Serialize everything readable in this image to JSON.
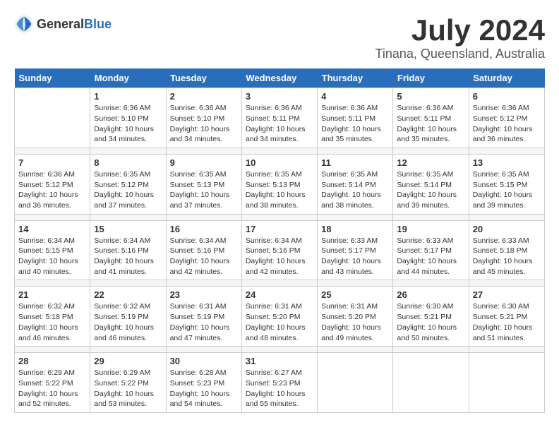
{
  "logo": {
    "general": "General",
    "blue": "Blue"
  },
  "title": "July 2024",
  "subtitle": "Tinana, Queensland, Australia",
  "days_of_week": [
    "Sunday",
    "Monday",
    "Tuesday",
    "Wednesday",
    "Thursday",
    "Friday",
    "Saturday"
  ],
  "weeks": [
    [
      {
        "day": "",
        "info": ""
      },
      {
        "day": "1",
        "info": "Sunrise: 6:36 AM\nSunset: 5:10 PM\nDaylight: 10 hours\nand 34 minutes."
      },
      {
        "day": "2",
        "info": "Sunrise: 6:36 AM\nSunset: 5:10 PM\nDaylight: 10 hours\nand 34 minutes."
      },
      {
        "day": "3",
        "info": "Sunrise: 6:36 AM\nSunset: 5:11 PM\nDaylight: 10 hours\nand 34 minutes."
      },
      {
        "day": "4",
        "info": "Sunrise: 6:36 AM\nSunset: 5:11 PM\nDaylight: 10 hours\nand 35 minutes."
      },
      {
        "day": "5",
        "info": "Sunrise: 6:36 AM\nSunset: 5:11 PM\nDaylight: 10 hours\nand 35 minutes."
      },
      {
        "day": "6",
        "info": "Sunrise: 6:36 AM\nSunset: 5:12 PM\nDaylight: 10 hours\nand 36 minutes."
      }
    ],
    [
      {
        "day": "7",
        "info": "Sunrise: 6:36 AM\nSunset: 5:12 PM\nDaylight: 10 hours\nand 36 minutes."
      },
      {
        "day": "8",
        "info": "Sunrise: 6:35 AM\nSunset: 5:12 PM\nDaylight: 10 hours\nand 37 minutes."
      },
      {
        "day": "9",
        "info": "Sunrise: 6:35 AM\nSunset: 5:13 PM\nDaylight: 10 hours\nand 37 minutes."
      },
      {
        "day": "10",
        "info": "Sunrise: 6:35 AM\nSunset: 5:13 PM\nDaylight: 10 hours\nand 38 minutes."
      },
      {
        "day": "11",
        "info": "Sunrise: 6:35 AM\nSunset: 5:14 PM\nDaylight: 10 hours\nand 38 minutes."
      },
      {
        "day": "12",
        "info": "Sunrise: 6:35 AM\nSunset: 5:14 PM\nDaylight: 10 hours\nand 39 minutes."
      },
      {
        "day": "13",
        "info": "Sunrise: 6:35 AM\nSunset: 5:15 PM\nDaylight: 10 hours\nand 39 minutes."
      }
    ],
    [
      {
        "day": "14",
        "info": "Sunrise: 6:34 AM\nSunset: 5:15 PM\nDaylight: 10 hours\nand 40 minutes."
      },
      {
        "day": "15",
        "info": "Sunrise: 6:34 AM\nSunset: 5:16 PM\nDaylight: 10 hours\nand 41 minutes."
      },
      {
        "day": "16",
        "info": "Sunrise: 6:34 AM\nSunset: 5:16 PM\nDaylight: 10 hours\nand 42 minutes."
      },
      {
        "day": "17",
        "info": "Sunrise: 6:34 AM\nSunset: 5:16 PM\nDaylight: 10 hours\nand 42 minutes."
      },
      {
        "day": "18",
        "info": "Sunrise: 6:33 AM\nSunset: 5:17 PM\nDaylight: 10 hours\nand 43 minutes."
      },
      {
        "day": "19",
        "info": "Sunrise: 6:33 AM\nSunset: 5:17 PM\nDaylight: 10 hours\nand 44 minutes."
      },
      {
        "day": "20",
        "info": "Sunrise: 6:33 AM\nSunset: 5:18 PM\nDaylight: 10 hours\nand 45 minutes."
      }
    ],
    [
      {
        "day": "21",
        "info": "Sunrise: 6:32 AM\nSunset: 5:18 PM\nDaylight: 10 hours\nand 46 minutes."
      },
      {
        "day": "22",
        "info": "Sunrise: 6:32 AM\nSunset: 5:19 PM\nDaylight: 10 hours\nand 46 minutes."
      },
      {
        "day": "23",
        "info": "Sunrise: 6:31 AM\nSunset: 5:19 PM\nDaylight: 10 hours\nand 47 minutes."
      },
      {
        "day": "24",
        "info": "Sunrise: 6:31 AM\nSunset: 5:20 PM\nDaylight: 10 hours\nand 48 minutes."
      },
      {
        "day": "25",
        "info": "Sunrise: 6:31 AM\nSunset: 5:20 PM\nDaylight: 10 hours\nand 49 minutes."
      },
      {
        "day": "26",
        "info": "Sunrise: 6:30 AM\nSunset: 5:21 PM\nDaylight: 10 hours\nand 50 minutes."
      },
      {
        "day": "27",
        "info": "Sunrise: 6:30 AM\nSunset: 5:21 PM\nDaylight: 10 hours\nand 51 minutes."
      }
    ],
    [
      {
        "day": "28",
        "info": "Sunrise: 6:29 AM\nSunset: 5:22 PM\nDaylight: 10 hours\nand 52 minutes."
      },
      {
        "day": "29",
        "info": "Sunrise: 6:29 AM\nSunset: 5:22 PM\nDaylight: 10 hours\nand 53 minutes."
      },
      {
        "day": "30",
        "info": "Sunrise: 6:28 AM\nSunset: 5:23 PM\nDaylight: 10 hours\nand 54 minutes."
      },
      {
        "day": "31",
        "info": "Sunrise: 6:27 AM\nSunset: 5:23 PM\nDaylight: 10 hours\nand 55 minutes."
      },
      {
        "day": "",
        "info": ""
      },
      {
        "day": "",
        "info": ""
      },
      {
        "day": "",
        "info": ""
      }
    ]
  ]
}
